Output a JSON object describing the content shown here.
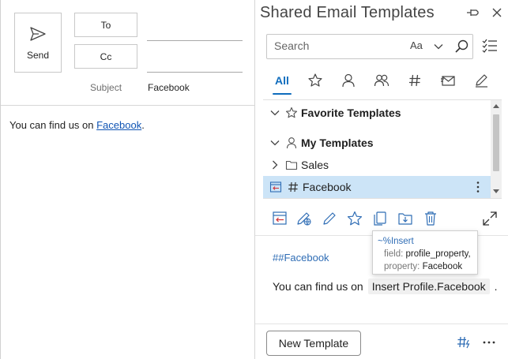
{
  "compose": {
    "send_label": "Send",
    "to_label": "To",
    "cc_label": "Cc",
    "subject_label": "Subject",
    "subject_value": "Facebook",
    "body_prefix": "You can find us on ",
    "body_link": "Facebook",
    "body_suffix": "."
  },
  "pane": {
    "title": "Shared Email Templates",
    "search": {
      "placeholder": "Search",
      "case_toggle": "Aa"
    },
    "tabs": [
      {
        "label": "All",
        "selected": true
      },
      {
        "icon": "star-icon"
      },
      {
        "icon": "person-icon"
      },
      {
        "icon": "people-icon"
      },
      {
        "icon": "hashtag-icon"
      },
      {
        "icon": "envelope-icon"
      },
      {
        "icon": "pen-icon"
      }
    ],
    "tree": {
      "favorite": "Favorite Templates",
      "my": "My Templates",
      "sales": "Sales",
      "facebook": "Facebook"
    },
    "tooltip": {
      "head": "~%Insert",
      "field_key": "field:",
      "field_val": "profile_property,",
      "property_key": "property:",
      "property_val": "Facebook"
    },
    "preview": {
      "hashtag": "##Facebook",
      "text": "You can find us on",
      "macro": "Insert Profile.Facebook",
      "suffix": "."
    },
    "new_template_label": "New Template"
  },
  "colors": {
    "accent": "#0f6cbd",
    "selection": "#cce4f7",
    "link": "#0f54b4"
  }
}
